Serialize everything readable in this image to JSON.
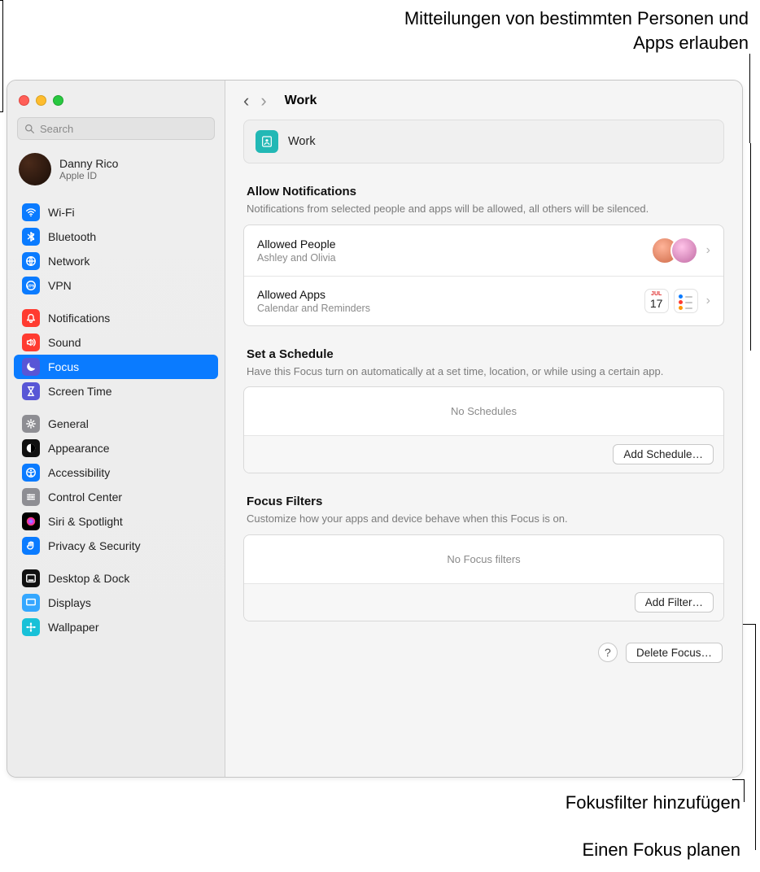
{
  "callouts": {
    "top": "Mitteilungen von bestimmten Personen und Apps erlauben",
    "add_filter": "Fokusfilter hinzufügen",
    "add_schedule": "Einen Fokus planen"
  },
  "search": {
    "placeholder": "Search"
  },
  "account": {
    "name": "Danny Rico",
    "sub": "Apple ID"
  },
  "sidebar": {
    "group1": [
      {
        "label": "Wi-Fi",
        "color": "#0a7bff",
        "icon": "wifi"
      },
      {
        "label": "Bluetooth",
        "color": "#0a7bff",
        "icon": "bluetooth"
      },
      {
        "label": "Network",
        "color": "#0a7bff",
        "icon": "globe"
      },
      {
        "label": "VPN",
        "color": "#0a7bff",
        "icon": "vpn"
      }
    ],
    "group2": [
      {
        "label": "Notifications",
        "color": "#ff3b30",
        "icon": "bell"
      },
      {
        "label": "Sound",
        "color": "#ff3b30",
        "icon": "sound"
      },
      {
        "label": "Focus",
        "color": "#5856d6",
        "icon": "moon",
        "selected": true
      },
      {
        "label": "Screen Time",
        "color": "#5856d6",
        "icon": "hourglass"
      }
    ],
    "group3": [
      {
        "label": "General",
        "color": "#8e8e93",
        "icon": "gear"
      },
      {
        "label": "Appearance",
        "color": "#111111",
        "icon": "appearance"
      },
      {
        "label": "Accessibility",
        "color": "#0a7bff",
        "icon": "accessibility"
      },
      {
        "label": "Control Center",
        "color": "#8e8e93",
        "icon": "sliders"
      },
      {
        "label": "Siri & Spotlight",
        "color": "#000000",
        "icon": "siri"
      },
      {
        "label": "Privacy & Security",
        "color": "#0a7bff",
        "icon": "hand"
      }
    ],
    "group4": [
      {
        "label": "Desktop & Dock",
        "color": "#111111",
        "icon": "dock"
      },
      {
        "label": "Displays",
        "color": "#34a7ff",
        "icon": "display"
      },
      {
        "label": "Wallpaper",
        "color": "#18c1d8",
        "icon": "flower"
      }
    ]
  },
  "header": {
    "title": "Work"
  },
  "focus": {
    "name": "Work"
  },
  "allow": {
    "title": "Allow Notifications",
    "desc": "Notifications from selected people and apps will be allowed, all others will be silenced.",
    "people": {
      "title": "Allowed People",
      "sub": "Ashley and Olivia"
    },
    "apps": {
      "title": "Allowed Apps",
      "sub": "Calendar and Reminders",
      "cal_day": "17",
      "cal_dow": "JUL"
    }
  },
  "schedule": {
    "title": "Set a Schedule",
    "desc": "Have this Focus turn on automatically at a set time, location, or while using a certain app.",
    "empty": "No Schedules",
    "button": "Add Schedule…"
  },
  "filters": {
    "title": "Focus Filters",
    "desc": "Customize how your apps and device behave when this Focus is on.",
    "empty": "No Focus filters",
    "button": "Add Filter…"
  },
  "delete_btn": "Delete Focus…",
  "help": "?"
}
